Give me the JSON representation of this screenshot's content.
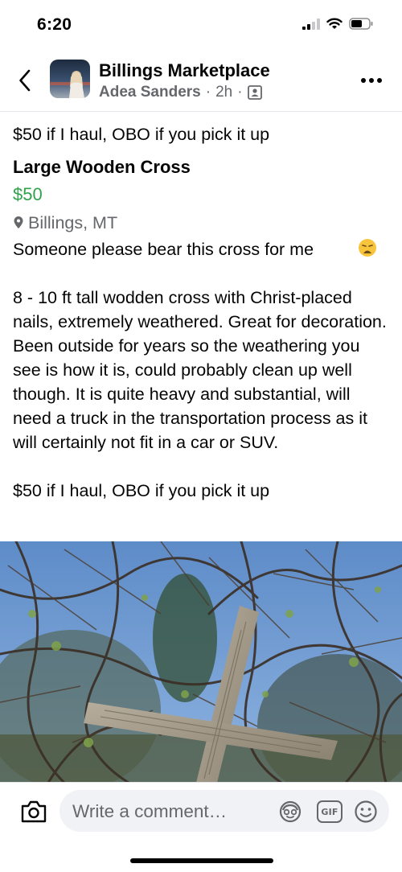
{
  "status": {
    "time": "6:20"
  },
  "header": {
    "group_name": "Billings Marketplace",
    "author": "Adea Sanders",
    "separator": "·",
    "time_ago": "2h"
  },
  "post": {
    "summary": "$50 if I haul, OBO if you pick it up",
    "title": "Large Wooden Cross",
    "price": "$50",
    "location": "Billings, MT",
    "description": "Someone please bear this cross for me\n\n8 - 10 ft tall wodden cross with Christ-placed nails, extremely weathered. Great for decoration. Been outside for years so the weathering you see is how it is, could probably clean up well though. It is quite heavy and substantial, will need a truck in the transportation process as it will certainly not fit in a car or SUV.\n\n$50 if I haul, OBO if you pick it up"
  },
  "comment": {
    "placeholder": "Write a comment…",
    "gif_label": "GIF"
  },
  "icons": {
    "back": "chevron-left-icon",
    "more": "more-horizontal-icon",
    "privacy": "group-member-icon",
    "location": "map-pin-icon",
    "camera": "camera-icon",
    "avatar_sticker": "avatar-sticker-icon",
    "gif": "gif-icon",
    "emoji": "smiley-icon"
  },
  "colors": {
    "price_green": "#31a24c",
    "secondary_text": "#65676b",
    "input_bg": "#f0f2f5"
  }
}
